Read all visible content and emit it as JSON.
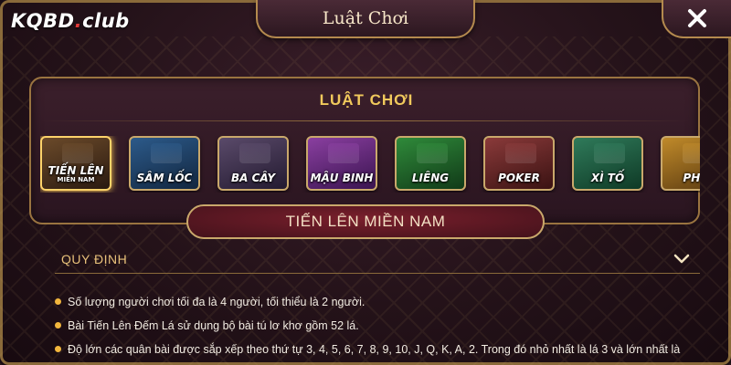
{
  "brand": {
    "logo_main": "KQBD",
    "logo_dot": ".",
    "logo_suffix": "club"
  },
  "window": {
    "title": "Luật Chơi",
    "close_icon": "close-icon"
  },
  "panel": {
    "title": "LUẬT CHƠI"
  },
  "games": [
    {
      "label": "TIẾN LÊN",
      "sub": "MIỀN NAM",
      "colors": [
        "#6b4a2a",
        "#2a1a10"
      ],
      "active": true
    },
    {
      "label": "SÂM LỐC",
      "sub": "",
      "colors": [
        "#2c5a8a",
        "#12263f"
      ],
      "active": false
    },
    {
      "label": "BA CÂY",
      "sub": "",
      "colors": [
        "#5a4a6a",
        "#231a30"
      ],
      "active": false
    },
    {
      "label": "MẬU BINH",
      "sub": "",
      "colors": [
        "#8a3fa0",
        "#3a1450"
      ],
      "active": false
    },
    {
      "label": "LIÊNG",
      "sub": "",
      "colors": [
        "#2f8a3a",
        "#113a18"
      ],
      "active": false
    },
    {
      "label": "POKER",
      "sub": "",
      "colors": [
        "#8a3a3a",
        "#3a1212"
      ],
      "active": false
    },
    {
      "label": "XÌ TỐ",
      "sub": "",
      "colors": [
        "#2f7a5a",
        "#0f3a26"
      ],
      "active": false
    },
    {
      "label": "PHỎ",
      "sub": "",
      "colors": [
        "#c08a2a",
        "#5a3a10"
      ],
      "active": false
    }
  ],
  "selected_game": {
    "title": "TIẾN LÊN MIỀN NAM"
  },
  "section": {
    "label": "QUY ĐỊNH",
    "icon": "chevron-down-icon"
  },
  "rules": [
    "Số lượng người chơi tối đa là 4 người, tối thiểu là 2 người.",
    "Bài Tiến Lên Đếm Lá sử dụng bộ bài tú lơ khơ gồm 52 lá.",
    "Độ lớn các quân bài được sắp xếp theo thứ tự 3, 4, 5, 6, 7, 8, 9, 10, J, Q, K, A, 2. Trong đó nhỏ nhất là lá 3 và lớn nhất là"
  ]
}
